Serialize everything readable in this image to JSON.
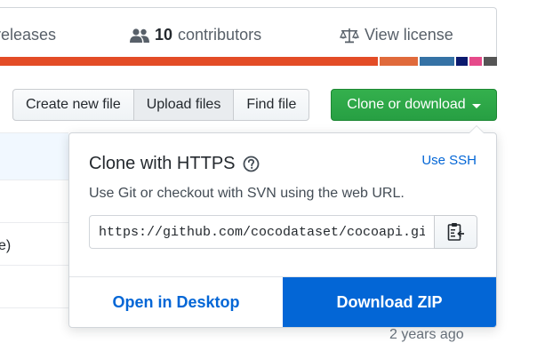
{
  "summary": {
    "releases_label": "releases",
    "contributors_count": "10",
    "contributors_label": "contributors",
    "license_label": "View license"
  },
  "language_bar": [
    {
      "color": "#e34c26",
      "share": 0.775
    },
    {
      "color": "#e06a3b",
      "share": 0.078
    },
    {
      "color": "#3572a5",
      "share": 0.07
    },
    {
      "color": "#0b1a6e",
      "share": 0.025
    },
    {
      "color": "#e64a8a",
      "share": 0.025
    },
    {
      "color": "#555555",
      "share": 0.027
    }
  ],
  "toolbar": {
    "create_label": "Create new file",
    "upload_label": "Upload files",
    "find_label": "Find file",
    "clone_label": "Clone or download"
  },
  "background": {
    "fragment": "e)",
    "age": "2 years ago"
  },
  "clone_popover": {
    "title": "Clone with HTTPS",
    "use_ssh_label": "Use SSH",
    "description": "Use Git or checkout with SVN using the web URL.",
    "url": "https://github.com/cocodataset/cocoapi.git",
    "open_desktop_label": "Open in Desktop",
    "download_zip_label": "Download ZIP"
  }
}
